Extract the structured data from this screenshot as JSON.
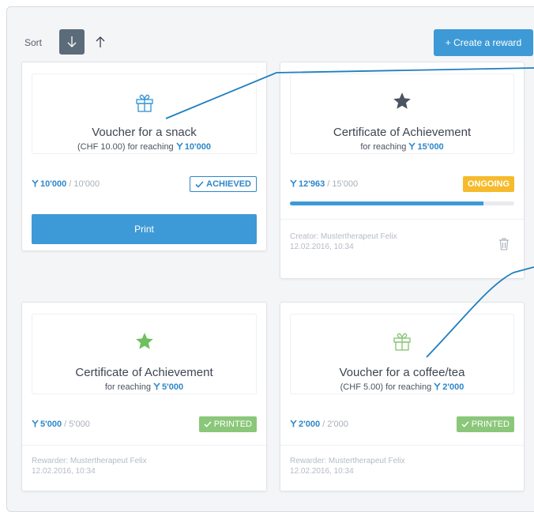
{
  "toolbar": {
    "sort_label": "Sort",
    "create_label": "+ Create a reward"
  },
  "cards": [
    {
      "icon": "gift-icon",
      "icon_color": "#3d9ad6",
      "title": "Voucher for a snack",
      "subtitle_prefix": "(CHF 10.00) for reaching",
      "target": "10'000",
      "current": "10'000",
      "goal": "/ 10'000",
      "status": "ACHIEVED",
      "action": "Print"
    },
    {
      "icon": "star-icon",
      "icon_color": "#4a5463",
      "title": "Certificate of Achievement",
      "subtitle_prefix": "for reaching",
      "target": "15'000",
      "current": "12'963",
      "goal": "/ 15'000",
      "status": "ONGOING",
      "progress": 0.864,
      "meta_line1": "Creator: Mustertherapeut Felix",
      "meta_line2": "12.02.2016, 10:34"
    },
    {
      "icon": "star-icon",
      "icon_color": "#6fbf5e",
      "title": "Certificate of Achievement",
      "subtitle_prefix": "for reaching",
      "target": "5'000",
      "current": "5'000",
      "goal": "/ 5'000",
      "status": "PRINTED",
      "meta_line1": "Rewarder: Mustertherapeut Felix",
      "meta_line2": "12.02.2016, 10:34"
    },
    {
      "icon": "gift-icon",
      "icon_color": "#8bc77a",
      "title": "Voucher for a coffee/tea",
      "subtitle_prefix": "(CHF 5.00) for reaching",
      "target": "2'000",
      "current": "2'000",
      "goal": "/ 2'000",
      "status": "PRINTED",
      "meta_line1": "Rewarder: Mustertherapeut Felix",
      "meta_line2": "12.02.2016, 10:34"
    }
  ],
  "colors": {
    "accent": "#3d9ad6",
    "ongoing": "#f5bb2c",
    "printed": "#8bc77a",
    "callout_line": "#1f7fbf"
  }
}
